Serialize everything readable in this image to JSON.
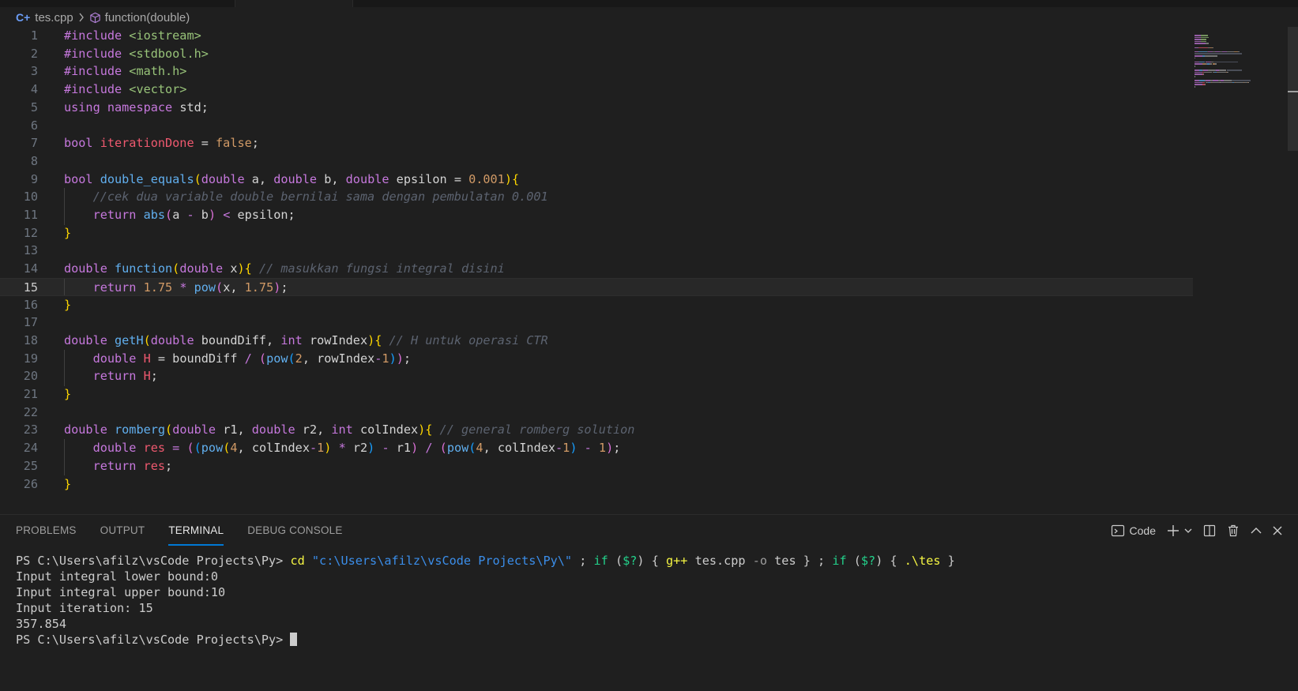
{
  "breadcrumb": {
    "file_icon_glyph": "C+",
    "file": "tes.cpp",
    "symbol": "function(double)"
  },
  "editor": {
    "current_line": 15,
    "lines": [
      {
        "n": "1",
        "tokens": [
          [
            "t-inc",
            "#include "
          ],
          [
            "t-lt",
            "<iostream>"
          ]
        ]
      },
      {
        "n": "2",
        "tokens": [
          [
            "t-inc",
            "#include "
          ],
          [
            "t-lt",
            "<stdbool.h>"
          ]
        ]
      },
      {
        "n": "3",
        "tokens": [
          [
            "t-inc",
            "#include "
          ],
          [
            "t-lt",
            "<math.h>"
          ]
        ]
      },
      {
        "n": "4",
        "tokens": [
          [
            "t-inc",
            "#include "
          ],
          [
            "t-lt",
            "<vector>"
          ]
        ]
      },
      {
        "n": "5",
        "tokens": [
          [
            "t-kw",
            "using "
          ],
          [
            "t-kw",
            "namespace "
          ],
          [
            "t-id",
            "std;"
          ]
        ]
      },
      {
        "n": "6",
        "tokens": []
      },
      {
        "n": "7",
        "tokens": [
          [
            "t-type",
            "bool "
          ],
          [
            "t-gv",
            "iterationDone "
          ],
          [
            "t-id",
            "= "
          ],
          [
            "t-num",
            "false"
          ],
          [
            "t-id",
            ";"
          ]
        ]
      },
      {
        "n": "8",
        "tokens": []
      },
      {
        "n": "9",
        "tokens": [
          [
            "t-type",
            "bool "
          ],
          [
            "t-fn",
            "double_equals"
          ],
          [
            "t-b1",
            "("
          ],
          [
            "t-type",
            "double "
          ],
          [
            "t-id",
            "a, "
          ],
          [
            "t-type",
            "double "
          ],
          [
            "t-id",
            "b, "
          ],
          [
            "t-type",
            "double "
          ],
          [
            "t-id",
            "epsilon = "
          ],
          [
            "t-num",
            "0.001"
          ],
          [
            "t-b1",
            "){"
          ]
        ]
      },
      {
        "n": "10",
        "indent": true,
        "tokens": [
          [
            "t-cm",
            "    //cek dua variable double bernilai sama dengan pembulatan 0.001"
          ]
        ]
      },
      {
        "n": "11",
        "indent": true,
        "tokens": [
          [
            "t-kw",
            "    return "
          ],
          [
            "t-fn",
            "abs"
          ],
          [
            "t-b2",
            "("
          ],
          [
            "t-id",
            "a "
          ],
          [
            "t-op",
            "- "
          ],
          [
            "t-id",
            "b"
          ],
          [
            "t-b2",
            ") "
          ],
          [
            "t-op",
            "< "
          ],
          [
            "t-id",
            "epsilon;"
          ]
        ]
      },
      {
        "n": "12",
        "tokens": [
          [
            "t-b1",
            "}"
          ]
        ]
      },
      {
        "n": "13",
        "tokens": []
      },
      {
        "n": "14",
        "tokens": [
          [
            "t-type",
            "double "
          ],
          [
            "t-fn",
            "function"
          ],
          [
            "t-b1",
            "("
          ],
          [
            "t-type",
            "double "
          ],
          [
            "t-id",
            "x"
          ],
          [
            "t-b1",
            "){ "
          ],
          [
            "t-cm",
            "// masukkan fungsi integral disini"
          ]
        ]
      },
      {
        "n": "15",
        "indent": true,
        "tokens": [
          [
            "t-kw",
            "    return "
          ],
          [
            "t-num",
            "1.75 "
          ],
          [
            "t-op",
            "* "
          ],
          [
            "t-fn",
            "pow"
          ],
          [
            "t-b2",
            "("
          ],
          [
            "t-id",
            "x, "
          ],
          [
            "t-num",
            "1.75"
          ],
          [
            "t-b2",
            ")"
          ],
          [
            "t-id",
            ";"
          ]
        ]
      },
      {
        "n": "16",
        "tokens": [
          [
            "t-b1",
            "}"
          ]
        ]
      },
      {
        "n": "17",
        "tokens": []
      },
      {
        "n": "18",
        "tokens": [
          [
            "t-type",
            "double "
          ],
          [
            "t-fn",
            "getH"
          ],
          [
            "t-b1",
            "("
          ],
          [
            "t-type",
            "double "
          ],
          [
            "t-id",
            "boundDiff, "
          ],
          [
            "t-type",
            "int "
          ],
          [
            "t-id",
            "rowIndex"
          ],
          [
            "t-b1",
            "){ "
          ],
          [
            "t-cm",
            "// H untuk operasi CTR"
          ]
        ]
      },
      {
        "n": "19",
        "indent": true,
        "tokens": [
          [
            "t-type",
            "    double "
          ],
          [
            "t-gv",
            "H "
          ],
          [
            "t-id",
            "= boundDiff "
          ],
          [
            "t-op",
            "/ "
          ],
          [
            "t-b2",
            "("
          ],
          [
            "t-fn",
            "pow"
          ],
          [
            "t-b3",
            "("
          ],
          [
            "t-num",
            "2"
          ],
          [
            "t-id",
            ", rowIndex"
          ],
          [
            "t-op",
            "-"
          ],
          [
            "t-num",
            "1"
          ],
          [
            "t-b3",
            ")"
          ],
          [
            "t-b2",
            ")"
          ],
          [
            "t-id",
            ";"
          ]
        ]
      },
      {
        "n": "20",
        "indent": true,
        "tokens": [
          [
            "t-kw",
            "    return "
          ],
          [
            "t-gv",
            "H"
          ],
          [
            "t-id",
            ";"
          ]
        ]
      },
      {
        "n": "21",
        "tokens": [
          [
            "t-b1",
            "}"
          ]
        ]
      },
      {
        "n": "22",
        "tokens": []
      },
      {
        "n": "23",
        "tokens": [
          [
            "t-type",
            "double "
          ],
          [
            "t-fn",
            "romberg"
          ],
          [
            "t-b1",
            "("
          ],
          [
            "t-type",
            "double "
          ],
          [
            "t-id",
            "r1, "
          ],
          [
            "t-type",
            "double "
          ],
          [
            "t-id",
            "r2, "
          ],
          [
            "t-type",
            "int "
          ],
          [
            "t-id",
            "colIndex"
          ],
          [
            "t-b1",
            "){ "
          ],
          [
            "t-cm",
            "// general romberg solution"
          ]
        ]
      },
      {
        "n": "24",
        "indent": true,
        "tokens": [
          [
            "t-type",
            "    double "
          ],
          [
            "t-gv",
            "res "
          ],
          [
            "t-op",
            "= "
          ],
          [
            "t-b2",
            "("
          ],
          [
            "t-b3",
            "("
          ],
          [
            "t-fn",
            "pow"
          ],
          [
            "t-b1",
            "("
          ],
          [
            "t-num",
            "4"
          ],
          [
            "t-id",
            ", colIndex"
          ],
          [
            "t-op",
            "-"
          ],
          [
            "t-num",
            "1"
          ],
          [
            "t-b1",
            ") "
          ],
          [
            "t-op",
            "* "
          ],
          [
            "t-id",
            "r2"
          ],
          [
            "t-b3",
            ") "
          ],
          [
            "t-op",
            "- "
          ],
          [
            "t-id",
            "r1"
          ],
          [
            "t-b2",
            ") "
          ],
          [
            "t-op",
            "/ "
          ],
          [
            "t-b2",
            "("
          ],
          [
            "t-fn",
            "pow"
          ],
          [
            "t-b3",
            "("
          ],
          [
            "t-num",
            "4"
          ],
          [
            "t-id",
            ", colIndex"
          ],
          [
            "t-op",
            "-"
          ],
          [
            "t-num",
            "1"
          ],
          [
            "t-b3",
            ") "
          ],
          [
            "t-op",
            "- "
          ],
          [
            "t-num",
            "1"
          ],
          [
            "t-b2",
            ")"
          ],
          [
            "t-id",
            ";"
          ]
        ]
      },
      {
        "n": "25",
        "indent": true,
        "tokens": [
          [
            "t-kw",
            "    return "
          ],
          [
            "t-gv",
            "res"
          ],
          [
            "t-id",
            ";"
          ]
        ]
      },
      {
        "n": "26",
        "tokens": [
          [
            "t-b1",
            "}"
          ]
        ]
      }
    ]
  },
  "panel": {
    "tabs": [
      "PROBLEMS",
      "OUTPUT",
      "TERMINAL",
      "DEBUG CONSOLE"
    ],
    "active_tab": "TERMINAL",
    "terminal_profile": "Code",
    "icons": [
      "terminal-icon",
      "plus-icon",
      "chevron-down-icon",
      "split-icon",
      "trash-icon",
      "chevron-up-icon",
      "close-icon"
    ]
  },
  "terminal": {
    "lines": [
      [
        [
          "tm-plain",
          "PS C:\\Users\\afilz\\vsCode Projects\\Py> "
        ],
        [
          "tm-cmd",
          "cd "
        ],
        [
          "tm-str",
          "\"c:\\Users\\afilz\\vsCode Projects\\Py\\\""
        ],
        [
          "tm-plain",
          " ; "
        ],
        [
          "tm-kw",
          "if "
        ],
        [
          "tm-plain",
          "("
        ],
        [
          "tm-kw",
          "$?"
        ],
        [
          "tm-plain",
          ") { "
        ],
        [
          "tm-cmd",
          "g++ "
        ],
        [
          "tm-plain",
          "tes.cpp "
        ],
        [
          "tm-op",
          "-o "
        ],
        [
          "tm-plain",
          "tes } ; "
        ],
        [
          "tm-kw",
          "if "
        ],
        [
          "tm-plain",
          "("
        ],
        [
          "tm-kw",
          "$?"
        ],
        [
          "tm-plain",
          ") { "
        ],
        [
          "tm-cmd",
          ".\\tes "
        ],
        [
          "tm-plain",
          "}"
        ]
      ],
      [
        [
          "tm-plain",
          "Input integral lower bound:0"
        ]
      ],
      [
        [
          "tm-plain",
          "Input integral upper bound:10"
        ]
      ],
      [
        [
          "tm-plain",
          "Input iteration: 15"
        ]
      ],
      [
        [
          "tm-plain",
          "357.854"
        ]
      ],
      [
        [
          "tm-plain",
          "PS C:\\Users\\afilz\\vsCode Projects\\Py> "
        ]
      ]
    ]
  },
  "colors": {
    "background": "#1f1f1f",
    "accent": "#0078d4"
  }
}
